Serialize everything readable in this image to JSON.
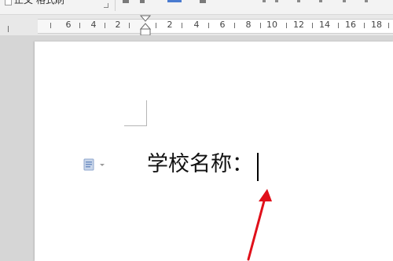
{
  "toolbar": {
    "style_text": "正文 格式刷"
  },
  "ruler": {
    "labels": [
      "6",
      "4",
      "2",
      "2",
      "4",
      "6",
      "8",
      "10",
      "12",
      "14",
      "16",
      "18"
    ]
  },
  "document": {
    "line_text": "学校名称："
  },
  "colors": {
    "annotation_arrow": "#e0101a",
    "page": "#ffffff",
    "workspace": "#d6d6d6"
  },
  "icons": {
    "paragraph_handle": "paragraph-menu-icon",
    "indent_marker": "indent-marker-icon"
  }
}
